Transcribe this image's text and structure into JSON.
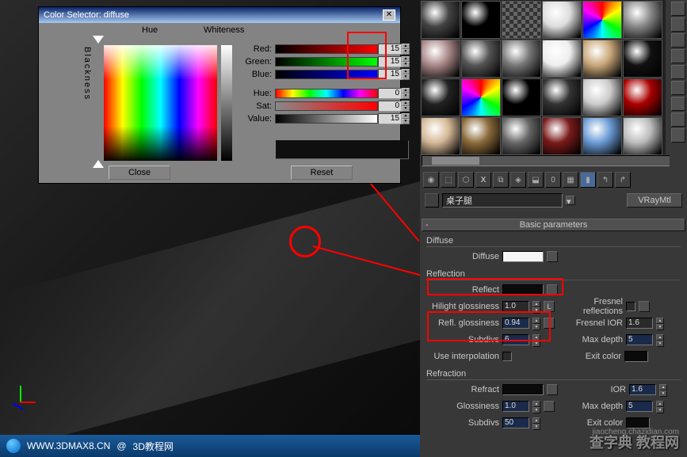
{
  "dialog": {
    "title": "Color Selector: diffuse",
    "hue_label": "Hue",
    "whiteness_label": "Whiteness",
    "blackness_label": "Blackness",
    "red_label": "Red:",
    "green_label": "Green:",
    "blue_label": "Blue:",
    "hue2_label": "Hue:",
    "sat_label": "Sat:",
    "value_label": "Value:",
    "red_val": "15",
    "green_val": "15",
    "blue_val": "15",
    "hue_val": "0",
    "sat_val": "0",
    "value_val": "15",
    "close_btn": "Close",
    "reset_btn": "Reset"
  },
  "material": {
    "name": "桌子腿",
    "type": "VRayMtl",
    "rollout_basic": "Basic parameters",
    "diffuse_section": "Diffuse",
    "diffuse_label": "Diffuse",
    "reflection_section": "Reflection",
    "reflect_label": "Reflect",
    "hilight_gloss_label": "Hilight glossiness",
    "hilight_gloss_val": "1.0",
    "l_label": "L",
    "fresnel_label": "Fresnel reflections",
    "refl_gloss_label": "Refl. glossiness",
    "refl_gloss_val": "0.94",
    "fresnel_ior_label": "Fresnel IOR",
    "fresnel_ior_val": "1.6",
    "subdivs_label": "Subdivs",
    "subdivs_val": "6",
    "max_depth_label": "Max depth",
    "max_depth_val": "5",
    "use_interp_label": "Use interpolation",
    "exit_color_label": "Exit color",
    "refraction_section": "Refraction",
    "refract_label": "Refract",
    "ior_label": "IOR",
    "ior_val": "1.6",
    "glossiness_label": "Glossiness",
    "glossiness_val": "1.0",
    "max_depth2_val": "5",
    "subdivs2_val": "50",
    "exit_color2_label": "Exit color",
    "toolbar_zero": "0"
  },
  "footer": {
    "url": "WWW.3DMAX8.CN",
    "sep": "@",
    "site": "3D教程网"
  },
  "watermark": {
    "main": "查字典 教程网",
    "sub": "jiaocheng.chazidian.com"
  }
}
